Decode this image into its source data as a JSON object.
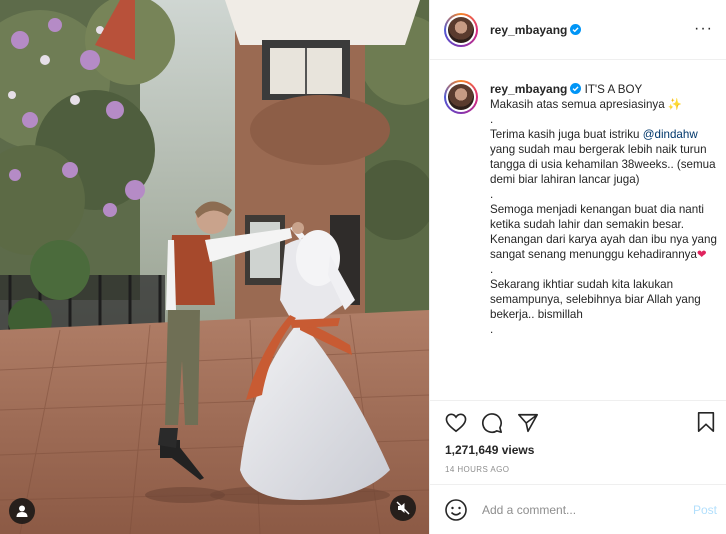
{
  "post": {
    "username": "rey_mbayang",
    "verified": true,
    "caption": {
      "username": "rey_mbayang",
      "line1": "IT'S A BOY",
      "line2": "Makasih atas semua apresiasinya",
      "dot1": ".",
      "para1_a": "Terima kasih juga buat istriku",
      "mention": "@dindahw",
      "para1_b": "yang sudah mau bergerak lebih naik turun tangga di usia kehamilan 38weeks.. (semua demi biar lahiran lancar juga)",
      "dot2": ".",
      "para2": "Semoga menjadi kenangan buat dia nanti ketika sudah lahir dan semakin besar. Kenangan dari karya ayah dan ibu nya yang sangat senang menunggu kehadirannya",
      "dot3": ".",
      "para3": "Sekarang ikhtiar sudah kita lakukan semampunya, selebihnya biar Allah yang bekerja.. bismillah",
      "dot4": "."
    },
    "views": "1,271,649 views",
    "timestamp": "14 HOURS AGO"
  },
  "comment_box": {
    "placeholder": "Add a comment...",
    "post_label": "Post"
  },
  "icons": {
    "more": "more-options-icon",
    "like": "heart-icon",
    "comment": "comment-icon",
    "share": "paper-plane-icon",
    "save": "bookmark-icon",
    "emoji": "emoji-icon",
    "tag": "user-tag-icon",
    "mute": "muted-speaker-icon"
  },
  "colors": {
    "verified": "#0095f6",
    "mention": "#00376b",
    "post_button": "#b2dffc",
    "secondary_text": "#8e8e8e"
  }
}
